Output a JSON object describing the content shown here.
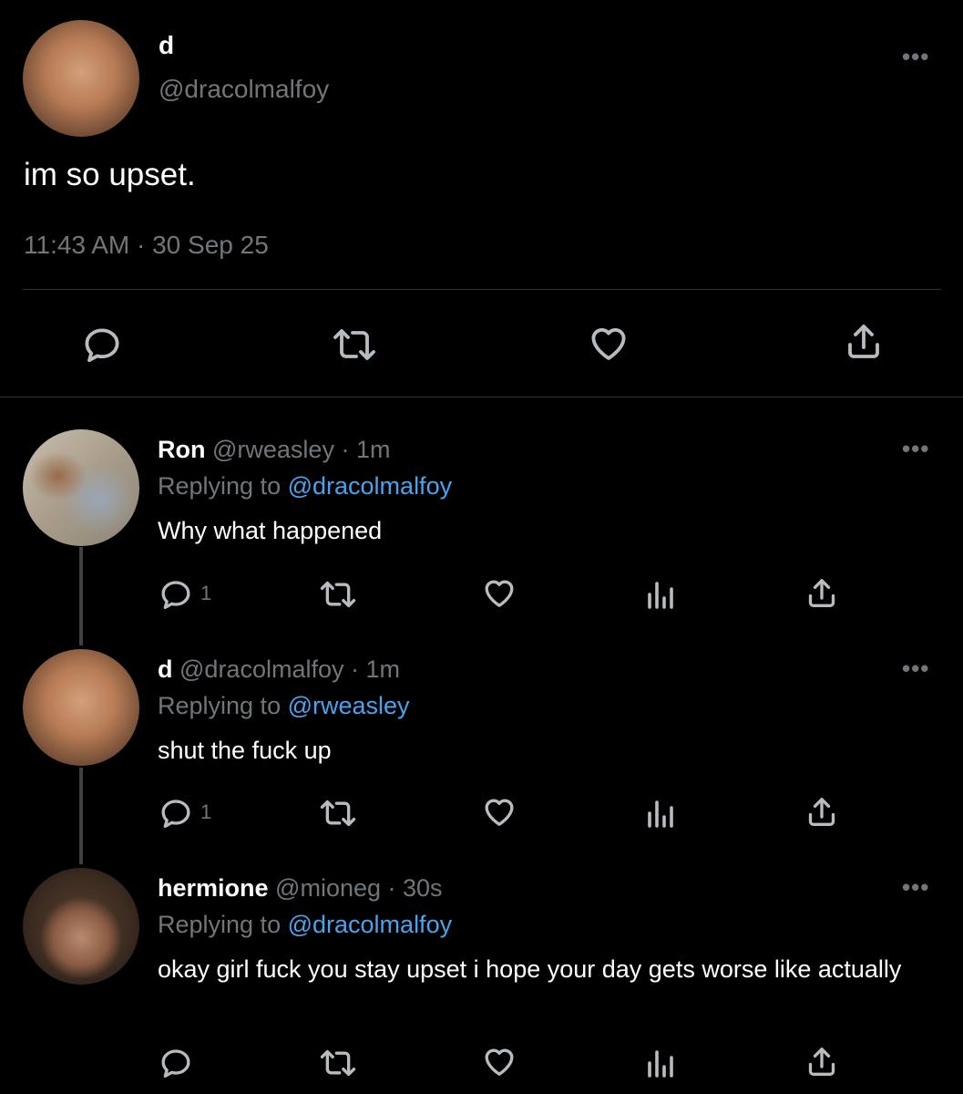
{
  "main_tweet": {
    "name": "d",
    "handle": "@dracolmalfoy",
    "text": "im so upset.",
    "timestamp": "11:43 AM · 30 Sep 25",
    "more_icon": "ellipsis-icon"
  },
  "actions_main": [
    "reply-icon",
    "retweet-icon",
    "like-icon",
    "share-icon"
  ],
  "replies": [
    {
      "name": "Ron",
      "handle": "@rweasley",
      "time": "· 1m",
      "replying_prefix": "Replying to",
      "replying_to": "@dracolmalfoy",
      "text": "Why what happened",
      "reply_count": "1"
    },
    {
      "name": "d",
      "handle": "@dracolmalfoy",
      "time": "· 1m",
      "replying_prefix": "Replying to",
      "replying_to": "@rweasley",
      "text": "shut the fuck up",
      "reply_count": "1"
    },
    {
      "name": "hermione",
      "handle": "@mioneg",
      "time": "· 30s",
      "replying_prefix": "Replying to",
      "replying_to": "@dracolmalfoy",
      "text": "okay girl fuck you stay upset i hope your day gets worse like actually",
      "reply_count": ""
    }
  ],
  "colors": {
    "background": "#000000",
    "text_primary": "#ffffff",
    "text_secondary": "#71767b",
    "link": "#4aa3ee",
    "divider": "#2f3336"
  }
}
